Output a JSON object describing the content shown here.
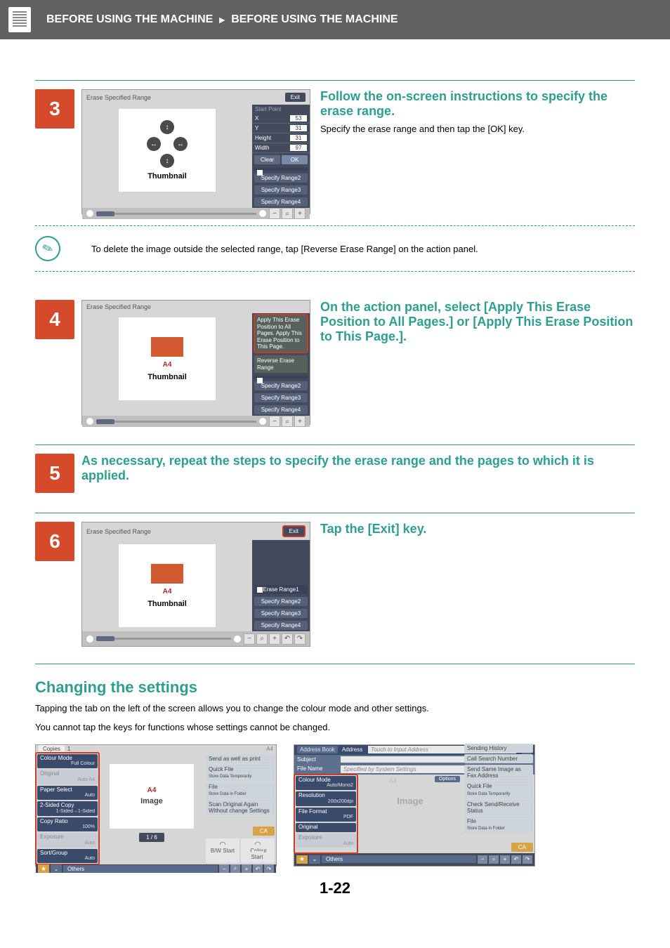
{
  "topbar": {
    "section_a": "BEFORE USING THE MACHINE",
    "section_b": "BEFORE USING THE MACHINE"
  },
  "steps": {
    "s3": {
      "num": "3",
      "title": "Follow the on-screen instructions to specify the erase range.",
      "desc": "Specify the erase range and then tap the [OK] key.",
      "shot": {
        "title": "Erase Specified Range",
        "exit": "Exit",
        "start_point": "Start Point",
        "x_l": "X",
        "x_v": "53",
        "y_l": "Y",
        "y_v": "31",
        "h_l": "Height",
        "h_v": "31",
        "w_l": "Width",
        "w_v": "97",
        "clear": "Clear",
        "ok": "OK",
        "thumb": "Thumbnail",
        "sr2": "Specify Range2",
        "sr3": "Specify Range3",
        "sr4": "Specify Range4"
      }
    },
    "note": "To delete the image outside the selected range, tap [Reverse Erase Range] on the action panel.",
    "s4": {
      "num": "4",
      "title": "On the action panel, select [Apply This Erase Position to All Pages.] or [Apply This Erase Position to This Page.].",
      "shot": {
        "title": "Erase Specified Range",
        "a4": "A4",
        "thumb": "Thumbnail",
        "act1": "Apply This Erase Position to All Pages. Apply This Erase Position to This Page.",
        "act2": "Reverse Erase Range",
        "sr2": "Specify Range2",
        "sr3": "Specify Range3",
        "sr4": "Specify Range4"
      }
    },
    "s5": {
      "num": "5",
      "title": "As necessary, repeat the steps to specify the erase range and the pages to which it is applied."
    },
    "s6": {
      "num": "6",
      "title": "Tap the [Exit] key.",
      "shot": {
        "title": "Erase Specified Range",
        "exit": "Exit",
        "a4": "A4",
        "thumb": "Thumbnail",
        "er1": "Erase Range1",
        "sr2": "Specify Range2",
        "sr3": "Specify Range3",
        "sr4": "Specify Range4"
      }
    }
  },
  "changing": {
    "title": "Changing the settings",
    "p1": "Tapping the tab on the left of the screen allows you to change the colour mode and other settings.",
    "p2": "You cannot tap the keys for functions whose settings cannot be changed."
  },
  "copy_shot": {
    "tab": "Copies",
    "copies_val": "1",
    "a4hdr": "A4",
    "left": {
      "cm_l": "Colour Mode",
      "cm_v": "Full Colour",
      "orig_l": "Original",
      "orig_v": "Auto A4",
      "ps_l": "Paper Select",
      "ps_v": "Auto",
      "sc_l": "2-Sided Copy",
      "sc_v": "1-Sided→1-Sided",
      "cr_l": "Copy Ratio",
      "cr_v": "100%",
      "ex_l": "Exposure",
      "ex_v": "Auto",
      "sg_l": "Sort/Group",
      "sg_v": "Auto"
    },
    "mid": {
      "a4": "A4",
      "image": "Image",
      "page": "1 / 6"
    },
    "right": {
      "r1": "Send as well as print",
      "r2a": "Quick File",
      "r2b": "Store Data Temporarily",
      "r3a": "File",
      "r3b": "Store Data in Folder",
      "r4": "Scan Original Again Without change Settings",
      "ca": "CA",
      "bw": "B/W Start",
      "col": "Colour Start"
    },
    "others": "Others"
  },
  "scan_shot": {
    "ab": "Address Book",
    "addr_l": "Address",
    "addr_ph": "Touch to Input Address",
    "r_top": "Sending History",
    "subj": "Subject",
    "fn": "File Name",
    "fn_ph": "Specified by System Settings",
    "left": {
      "cm_l": "Colour Mode",
      "cm_v": "Auto/Mono2",
      "res_l": "Resolution",
      "res_v": "200x200dpi",
      "ff_l": "File Format",
      "ff_v": "PDF",
      "orig_l": "Original",
      "ex_l": "Exposure",
      "ex_v": "Auto"
    },
    "mid_a4": "A4",
    "opt": "Options",
    "mid_img": "Image",
    "right": {
      "r1": "Call Search Number",
      "r2": "Send Same Image as Fax Address",
      "r3a": "Quick File",
      "r3b": "Store Data Temporarily",
      "r4": "Check Send/Receive Status",
      "r5a": "File",
      "r5b": "Store Data in Folder",
      "ca": "CA"
    },
    "others": "Others"
  },
  "page_num": "1-22"
}
